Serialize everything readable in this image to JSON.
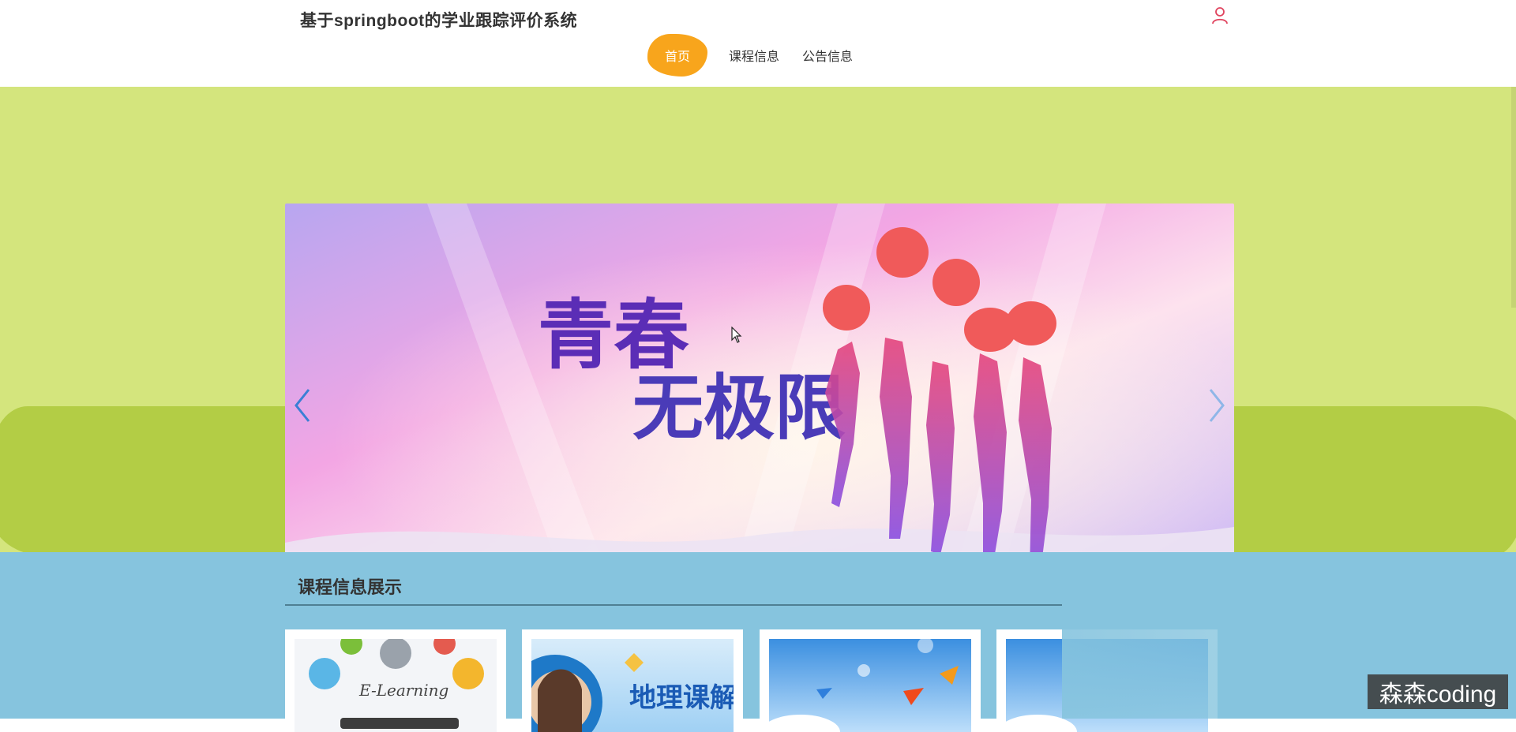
{
  "header": {
    "site_title": "基于springboot的学业跟踪评价系统",
    "nav": [
      {
        "label": "首页",
        "active": true
      },
      {
        "label": "课程信息",
        "active": false
      },
      {
        "label": "公告信息",
        "active": false
      }
    ],
    "user_icon": "user-icon"
  },
  "banner": {
    "text_line1": "青春",
    "text_line2": "无极限",
    "prev_icon": "chevron-left-icon",
    "next_icon": "chevron-right-icon"
  },
  "courses": {
    "section_title": "课程信息展示",
    "cards": [
      {
        "image_text": "E-Learning"
      },
      {
        "image_text": "地理课解"
      },
      {
        "image_text": ""
      },
      {
        "image_text": ""
      }
    ]
  },
  "watermark": "森森coding",
  "colors": {
    "nav_active": "#f8a51c",
    "hero_bg": "#d4e57d",
    "hero_blob": "#b3cd45",
    "section_bg": "#86c4de"
  }
}
